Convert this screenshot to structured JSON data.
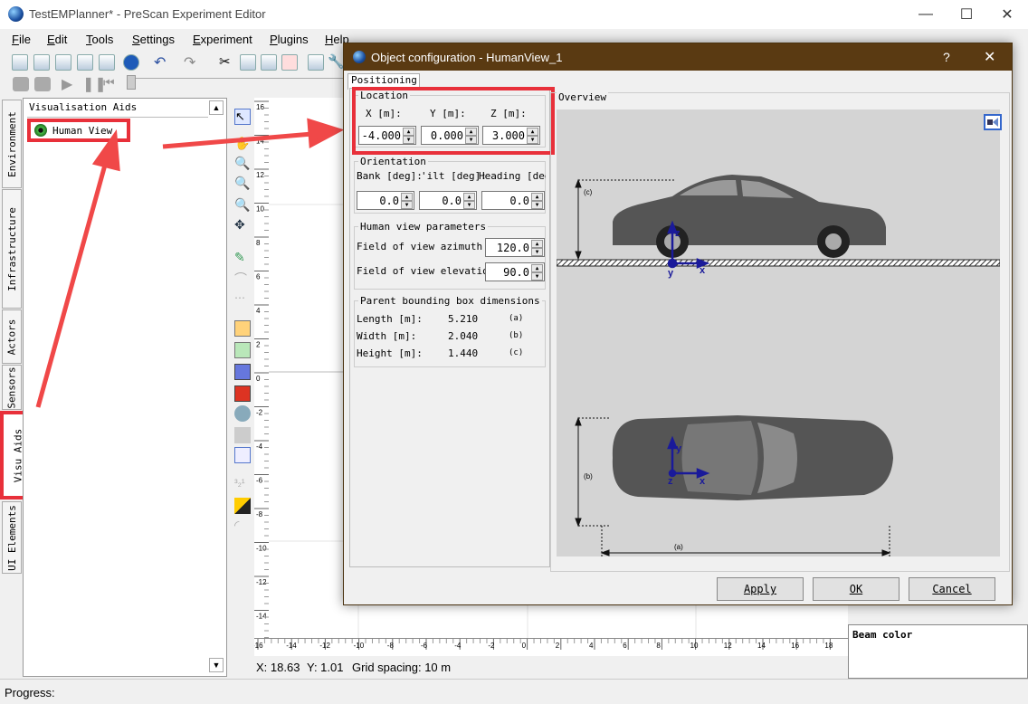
{
  "window": {
    "title": "TestEMPlanner* - PreScan Experiment Editor",
    "minimize": "—",
    "maximize": "☐",
    "close": "✕"
  },
  "menu": [
    "File",
    "Edit",
    "Tools",
    "Settings",
    "Experiment",
    "Plugins",
    "Help"
  ],
  "sidebar": {
    "tabs": [
      "Environment",
      "Infrastructure",
      "Actors",
      "Sensors",
      "Visu Aids",
      "UI Elements"
    ],
    "active_tab": "Visu Aids"
  },
  "tree": {
    "header": "Visualisation Aids",
    "items": [
      {
        "label": "Human View"
      }
    ]
  },
  "ruler": {
    "vertical": [
      "16",
      "14",
      "12",
      "10",
      "8",
      "6",
      "4",
      "2",
      "0",
      "-2",
      "-4",
      "-6",
      "-8",
      "-10",
      "-12",
      "-14",
      "-16"
    ],
    "horizontal": [
      "-16",
      "-14",
      "-12",
      "-10",
      "-8",
      "-6",
      "-4",
      "-2",
      "0",
      "2",
      "4",
      "6",
      "8",
      "10",
      "12",
      "14",
      "16",
      "18"
    ]
  },
  "status": {
    "x": "X: 18.63",
    "y": "Y: 1.01",
    "grid": "Grid spacing: 10 m",
    "progress": "Progress:"
  },
  "right_panel": {
    "beam_label": "Beam color"
  },
  "dialog": {
    "title": "Object configuration - HumanView_1",
    "help": "?",
    "close": "✕",
    "tab": "Positioning",
    "location": {
      "title": "Location",
      "x_label": "X [m]:",
      "y_label": "Y [m]:",
      "z_label": "Z [m]:",
      "x": "-4.000",
      "y": "0.000",
      "z": "3.000"
    },
    "orientation": {
      "title": "Orientation",
      "bank_label": "Bank [deg]:",
      "tilt_label": "'ilt [deg]:",
      "heading_label": "Heading [deg",
      "bank": "0.0",
      "tilt": "0.0",
      "heading": "0.0"
    },
    "human_view": {
      "title": "Human view parameters",
      "azimuth_label": "Field of view azimuth [",
      "elevation_label": "Field of view elevation",
      "azimuth": "120.0",
      "elevation": "90.0"
    },
    "bbox": {
      "title": "Parent bounding box dimensions",
      "length_label": "Length [m]:",
      "width_label": "Width [m]:",
      "height_label": "Height [m]:",
      "length": "5.210",
      "width": "2.040",
      "height": "1.440",
      "length_tag": "(a)",
      "width_tag": "(b)",
      "height_tag": "(c)"
    },
    "overview": {
      "title": "Overview",
      "dim_a": "(a)",
      "dim_b": "(b)",
      "dim_c": "(c)",
      "axis_x": "x",
      "axis_y": "y",
      "axis_z": "z"
    },
    "buttons": {
      "apply": "Apply",
      "ok": "OK",
      "cancel": "Cancel"
    }
  },
  "colors": {
    "highlight": "#e8303a",
    "dialog_title": "#5a3a12",
    "axis": "#1a1a9a"
  }
}
